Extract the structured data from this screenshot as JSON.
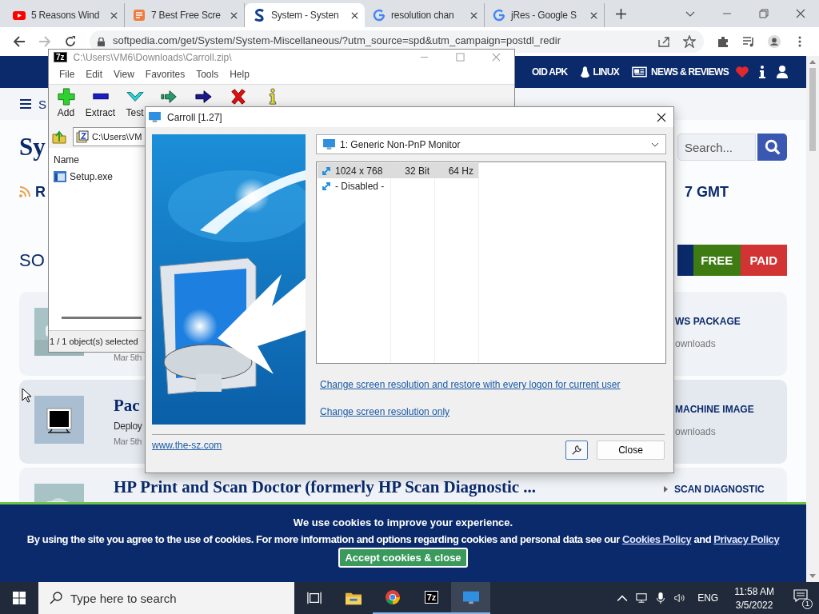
{
  "browser": {
    "tabs": [
      {
        "title": "5 Reasons Wind",
        "kind": "video",
        "selected": false
      },
      {
        "title": "7 Best Free Scre",
        "kind": "notes",
        "selected": false
      },
      {
        "title": "System - Systen",
        "kind": "site",
        "selected": true
      },
      {
        "title": "resolution chan",
        "kind": "google",
        "selected": false
      },
      {
        "title": "jRes - Google S",
        "kind": "google",
        "selected": false
      }
    ],
    "address": "softpedia.com/get/System/System-Miscellaneous/?utm_source=spd&utm_campaign=postdl_redir"
  },
  "site": {
    "nav": [
      {
        "label": "OID APK",
        "kind": "plain"
      },
      {
        "label": "LINUX",
        "kind": "linux"
      },
      {
        "label": "NEWS & REVIEWS",
        "kind": "news"
      }
    ],
    "subnav": "S",
    "heading": "Sy",
    "rss": "R",
    "updated": "7 GMT",
    "search": {
      "placeholder": "Search..."
    },
    "section": "SO",
    "filters": [
      {
        "label": "FREE",
        "color": "#3e7b12"
      },
      {
        "label": "PAID",
        "color": "#d23434"
      }
    ],
    "cards": [
      {
        "kind": "picture",
        "date": "Mar 5th",
        "tag": "WS PACKAGE",
        "downloads": "ownloads"
      },
      {
        "kind": "monitor",
        "title": "Pac",
        "desc": "Deploy",
        "date": "Mar 5th",
        "tag": "MACHINE IMAGE",
        "downloads": "ownloads"
      },
      {
        "kind": "picture",
        "title": "HP Print and Scan Doctor (formerly HP Scan Diagnostic ...",
        "tag": "SCAN DIAGNOSTIC"
      }
    ],
    "cookie": {
      "title": "We use cookies to improve your experience.",
      "text": "By using the site you agree to the use of cookies. For more information and options regarding cookies and personal data see our",
      "link1": "Cookies Policy",
      "joiner": "and",
      "link2": "Privacy Policy",
      "button": "Accept cookies & close"
    }
  },
  "sevenzip": {
    "logo": "7z",
    "title": "C:\\Users\\VM6\\Downloads\\Carroll.zip\\",
    "menu": [
      "File",
      "Edit",
      "View",
      "Favorites",
      "Tools",
      "Help"
    ],
    "tools": [
      {
        "kind": "add",
        "label": "Add"
      },
      {
        "kind": "extract",
        "label": "Extract"
      },
      {
        "kind": "test",
        "label": "Test"
      },
      {
        "kind": "copy"
      },
      {
        "kind": "move"
      },
      {
        "kind": "delete"
      },
      {
        "kind": "info"
      }
    ],
    "path": "C:\\Users\\VM",
    "column": "Name",
    "files": [
      {
        "name": "Setup.exe",
        "selected": false
      }
    ],
    "status": "1 / 1 object(s) selected"
  },
  "carroll": {
    "title": "Carroll [1.27]",
    "monitor": "1: Generic Non-PnP Monitor",
    "modes": [
      {
        "resolution": "1024 x 768",
        "depth": "32 Bit",
        "rate": "64 Hz",
        "selected": true
      },
      {
        "resolution": "- Disabled -",
        "selected": false
      }
    ],
    "links": [
      "Change screen resolution and restore with every logon for current user",
      "Change screen resolution only"
    ],
    "website": "www.the-sz.com",
    "close": "Close"
  },
  "taskbar": {
    "search": {
      "placeholder": "Type here to search"
    },
    "apps": [
      {
        "kind": "taskview",
        "running": false,
        "selected": false
      },
      {
        "kind": "explorer",
        "running": false,
        "selected": false
      },
      {
        "kind": "chrome",
        "running": true,
        "selected": false
      },
      {
        "kind": "sevenzip",
        "label": "7z",
        "running": true,
        "selected": false
      },
      {
        "kind": "monitor",
        "running": true,
        "selected": true
      }
    ],
    "language": "ENG",
    "time": "11:58 AM",
    "date": "3/5/2022",
    "notifications": "1"
  }
}
